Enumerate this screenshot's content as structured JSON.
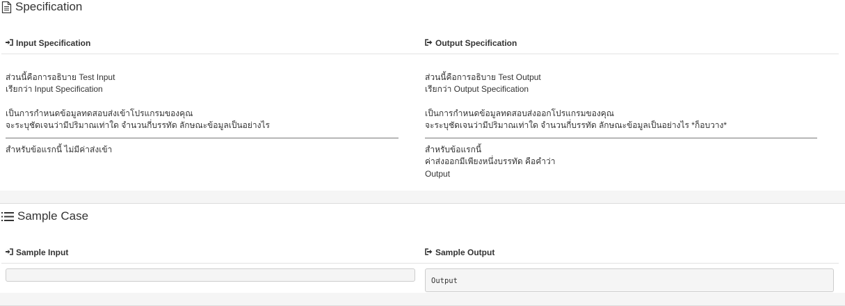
{
  "specification": {
    "title": "Specification",
    "input": {
      "heading": "Input Specification",
      "intro": [
        "ส่วนนี้คือการอธิบาย Test Input",
        "เรียกว่า Input Specification"
      ],
      "desc": [
        "เป็นการกำหนดข้อมูลทดสอบส่งเข้าโปรแกรมของคุณ",
        "จะระบุชัดเจนว่ามีปริมาณเท่าใด จำนวนกี่บรรทัด ลักษณะข้อมูลเป็นอย่างไร"
      ],
      "note": [
        "สำหรับข้อแรกนี้ ไม่มีค่าส่งเข้า"
      ]
    },
    "output": {
      "heading": "Output Specification",
      "intro": [
        "ส่วนนี้คือการอธิบาย Test Output",
        "เรียกว่า Output Specification"
      ],
      "desc": [
        "เป็นการกำหนดข้อมูลทดสอบส่งออกโปรแกรมของคุณ",
        "จะระบุชัดเจนว่ามีปริมาณเท่าใด จำนวนกี่บรรทัด ลักษณะข้อมูลเป็นอย่างไร *ก็อบวาง*"
      ],
      "note": [
        "สำหรับข้อแรกนี้",
        "ค่าส่งออกมีเพียงหนึ่งบรรทัด คือคำว่า",
        "Output"
      ]
    }
  },
  "sample_case": {
    "title": "Sample Case",
    "input": {
      "heading": "Sample Input",
      "value": ""
    },
    "output": {
      "heading": "Sample Output",
      "value": "Output"
    }
  },
  "icons": {
    "section_spec": "document-icon",
    "section_sample": "list-icon",
    "input": "sign-in-icon",
    "output": "sign-out-icon"
  }
}
